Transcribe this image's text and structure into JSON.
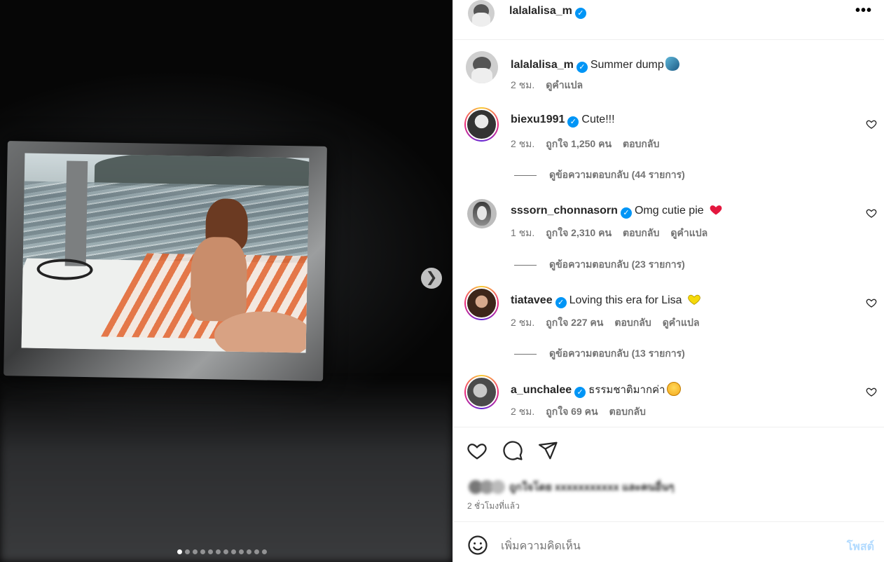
{
  "post": {
    "author": "lalalalisa_m",
    "media_dots": 12,
    "media_active": 1
  },
  "caption": {
    "username": "lalalalisa_m",
    "text": "Summer dump",
    "emoji": "dolphin",
    "time": "2 ชม.",
    "translate": "ดูคำแปล"
  },
  "comments": [
    {
      "username": "biexu1991",
      "text": "Cute!!!",
      "time": "2 ชม.",
      "likes": "ถูกใจ 1,250 คน",
      "reply": "ตอบกลับ",
      "translate": "",
      "view_replies": "ดูข้อความตอบกลับ (44 รายการ)"
    },
    {
      "username": "sssorn_chonnasorn",
      "text": "Omg cutie pie",
      "emoji": "red-heart",
      "time": "1 ชม.",
      "likes": "ถูกใจ 2,310 คน",
      "reply": "ตอบกลับ",
      "translate": "ดูคำแปล",
      "view_replies": "ดูข้อความตอบกลับ (23 รายการ)"
    },
    {
      "username": "tiatavee",
      "text": "Loving this era for Lisa",
      "emoji": "yellow-heart",
      "time": "2 ชม.",
      "likes": "ถูกใจ 227 คน",
      "reply": "ตอบกลับ",
      "translate": "ดูคำแปล",
      "view_replies": "ดูข้อความตอบกลับ (13 รายการ)"
    },
    {
      "username": "a_unchalee",
      "text": "ธรรมชาติมากค่า",
      "emoji": "smiling-face",
      "time": "2 ชม.",
      "likes": "ถูกใจ 69 คน",
      "reply": "ตอบกลับ",
      "translate": ""
    }
  ],
  "footer": {
    "liked_by_blurred": "ถูกใจโดย xxxxxxxxxxx และคนอื่นๆ",
    "timestamp": "2 ชั่วโมงที่แล้ว",
    "comment_placeholder": "เพิ่มความคิดเห็น",
    "post_button": "โพสต์"
  },
  "icons": {
    "more": "more-options-icon",
    "like": "heart-icon",
    "comment": "comment-icon",
    "share": "share-icon",
    "emoji_picker": "smiley-icon",
    "next": "chevron-right-icon"
  },
  "colors": {
    "verified": "#0095f6",
    "post_button_disabled": "#b3dbff",
    "secondary_text": "#737373"
  }
}
